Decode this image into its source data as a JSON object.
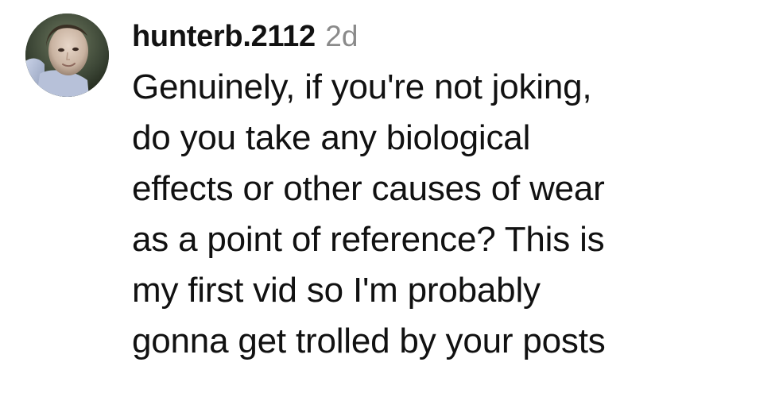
{
  "comment": {
    "username": "hunterb.2112",
    "timestamp": "2d",
    "lines": [
      "Genuinely, if you're not joking,",
      "do you take any biological",
      "effects or other causes of wear",
      "as a point of reference? This is",
      "my first vid so I'm probably",
      "gonna get trolled by your posts"
    ],
    "avatar_icon": "profile-photo"
  }
}
